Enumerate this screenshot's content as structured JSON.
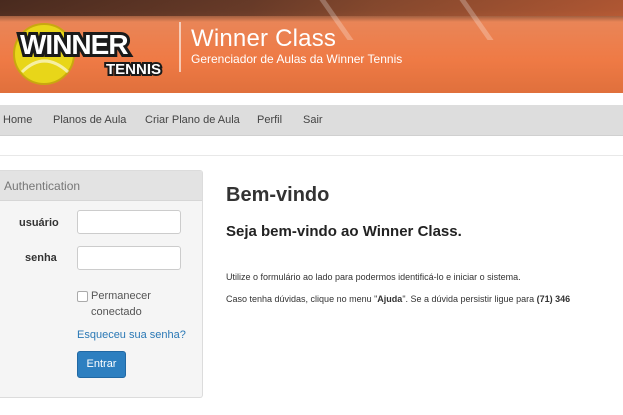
{
  "brand": {
    "logo_text_main": "WINNER",
    "logo_text_sub": "TENNIS",
    "title": "Winner Class",
    "subtitle": "Gerenciador de Aulas da Winner Tennis"
  },
  "nav": {
    "items": [
      "Home",
      "Planos de Aula",
      "Criar Plano de Aula",
      "Perfil",
      "Sair"
    ]
  },
  "auth": {
    "heading": "Authentication",
    "user_label": "usuário",
    "pass_label": "senha",
    "remember_label": "Permanecer conectado",
    "forgot_link": "Esqueceu sua senha?",
    "submit": "Entrar"
  },
  "main": {
    "title": "Bem-vindo",
    "subtitle": "Seja bem-vindo ao Winner Class.",
    "para1": "Utilize o formulário ao lado para podermos identificá-lo e iniciar o sistema.",
    "para2_a": "Caso tenha dúvidas, clique no menu \"",
    "para2_ajuda": "Ajuda",
    "para2_b": "\". Se a dúvida persistir ligue para ",
    "para2_phone": "(71) 346"
  },
  "colors": {
    "banner": "#ef7a45",
    "nav_bg": "#dddddd",
    "button": "#2d7fc0",
    "link": "#2a78b5"
  }
}
